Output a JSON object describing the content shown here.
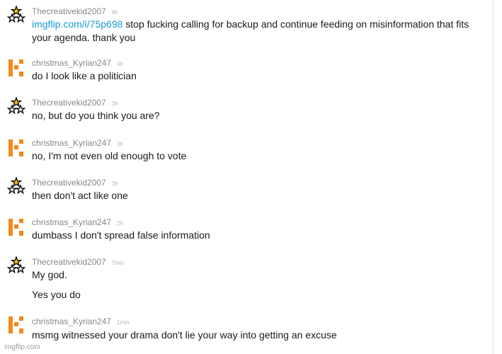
{
  "comments": [
    {
      "user": "Thecreativekid2007",
      "time": "4h",
      "avatar": "stars-avatar-icon",
      "link": "imgflip.com/i/75p698",
      "lines": [
        " stop fucking calling for backup and continue feeding on misinformation that fits",
        "your agenda. thank you"
      ]
    },
    {
      "user": "christmas_Kyrian247",
      "time": "4h",
      "avatar": "orange-k-avatar-icon",
      "lines": [
        "do I look like a politician"
      ]
    },
    {
      "user": "Thecreativekid2007",
      "time": "3h",
      "avatar": "stars-avatar-icon",
      "lines": [
        "no, but do you think you are?"
      ]
    },
    {
      "user": "christmas_Kyrian247",
      "time": "3h",
      "avatar": "orange-k-avatar-icon",
      "lines": [
        "no, I'm not even old enough to vote"
      ]
    },
    {
      "user": "Thecreativekid2007",
      "time": "3h",
      "avatar": "stars-avatar-icon",
      "lines": [
        "then don't act like one"
      ]
    },
    {
      "user": "christmas_Kyrian247",
      "time": "2h",
      "avatar": "orange-k-avatar-icon",
      "lines": [
        "dumbass I don't spread false information"
      ]
    },
    {
      "user": "Thecreativekid2007",
      "time": "7min",
      "avatar": "stars-avatar-icon",
      "lines": [
        "My god.",
        "Yes you do"
      ]
    },
    {
      "user": "christmas_Kyrian247",
      "time": "1min",
      "avatar": "orange-k-avatar-icon",
      "lines": [
        "msmg witnessed your drama don't lie your way into getting an excuse"
      ]
    }
  ],
  "watermark": "imgflip.com",
  "colors": {
    "accent_orange": "#f08a1d",
    "link_blue": "#1a9bd0",
    "star_yellow": "#f5c400"
  }
}
